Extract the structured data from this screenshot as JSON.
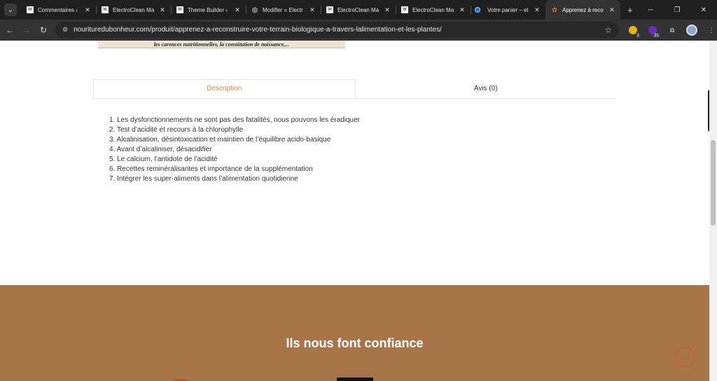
{
  "browser": {
    "tabs": [
      {
        "title": "Commentaires ‹",
        "icon": "wp"
      },
      {
        "title": "ElectroClean Ma",
        "icon": "wp"
      },
      {
        "title": "Theme Builder ‹",
        "icon": "wp"
      },
      {
        "title": "Modifier « Electr",
        "icon": "globe"
      },
      {
        "title": "ElectroClean Ma",
        "icon": "wp"
      },
      {
        "title": "ElectroClean Ma",
        "icon": "wp"
      },
      {
        "title": "Votre panier – el",
        "icon": "dot-blue"
      },
      {
        "title": "Apprenez à reco",
        "icon": "dot-orange",
        "active": true
      }
    ],
    "url": "nourituredubonheur.com/produit/apprenez-a-reconstruire-votre-terrain-biologique-a-travers-lalimentation-et-les-plantes/",
    "ext_badge_1": "1",
    "ext_badge_2": "31"
  },
  "page": {
    "image_caption": "les carences nutritionnelles, la constitution de naissance,...",
    "tabs": {
      "description": "Description",
      "reviews": "Avis (0)"
    },
    "description_items": [
      "1. Les dysfonctionnements ne sont pas des fatalités, nous pouvons les éradiquer",
      "2. Test d’acidité et recours à la chlorophylle",
      "3. Alcalinisation, désintoxication et maintien de l’équilibre acido-basique",
      "4. Avant d’alcaliniser, désacidifier",
      "5. Le calcium, l’antidote de l’acidité",
      "6. Recettes reminéralisantes et importance de la supplémentation",
      "7. Intégrer les super-aliments dans l’alimentation quotidienne"
    ],
    "trust_heading": "Ils nous font confiance"
  },
  "screenrec_label": "screenrec",
  "colors": {
    "accent": "#e0843c",
    "trust_bg": "#a87549"
  }
}
